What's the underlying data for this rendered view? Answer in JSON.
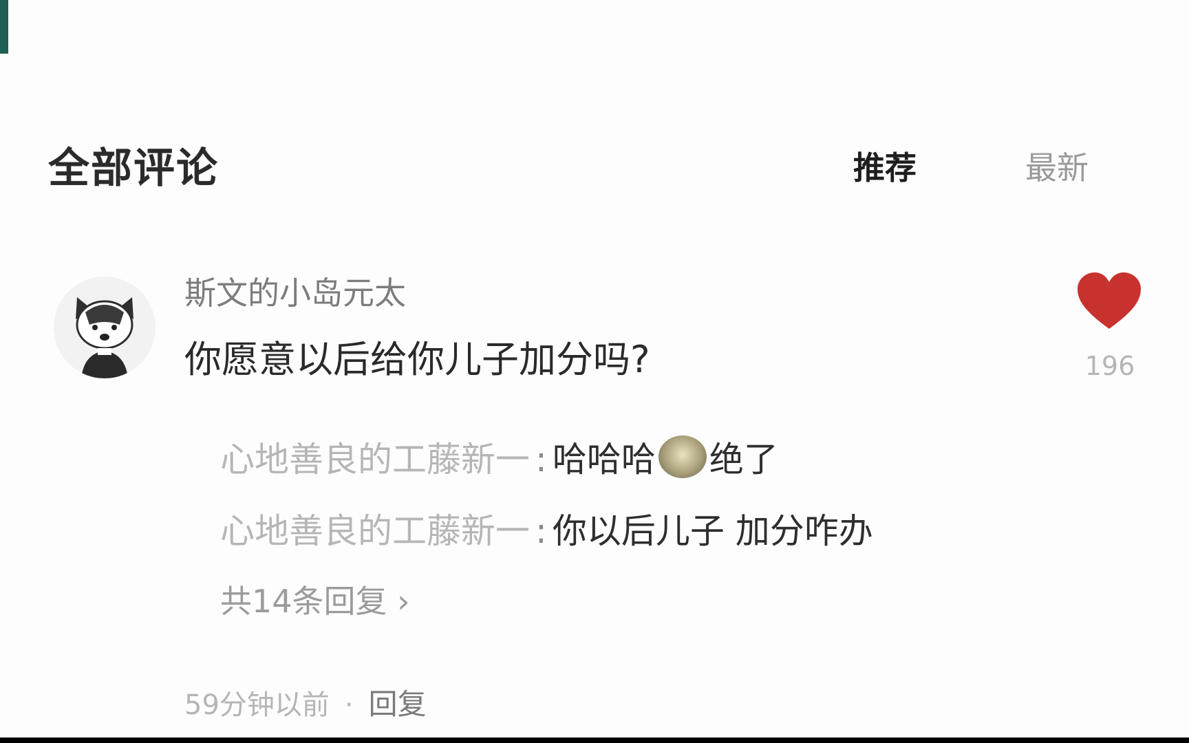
{
  "top_faded_text": "",
  "comments_section": {
    "title": "全部评论",
    "sort_tabs": [
      {
        "label": "推荐",
        "active": true
      },
      {
        "label": "最新",
        "active": false
      }
    ]
  },
  "comment": {
    "author": "斯文的小岛元太",
    "text": "你愿意以后给你儿子加分吗?",
    "likes": "196",
    "replies": [
      {
        "author": "心地善良的工藤新一",
        "separator": ":",
        "text_before": "哈哈哈",
        "emoji": "laughing-emoji-icon",
        "text_after": "绝了"
      },
      {
        "author": "心地善良的工藤新一",
        "separator": ":",
        "text_before": "你以后儿子 加分咋办",
        "text_after": ""
      }
    ],
    "more_replies": "共14条回复 ›",
    "time": "59分钟以前",
    "dot": "·",
    "reply_action": "回复"
  },
  "colors": {
    "accent_heart": "#c8322e",
    "left_edge": "#1f5e52"
  }
}
